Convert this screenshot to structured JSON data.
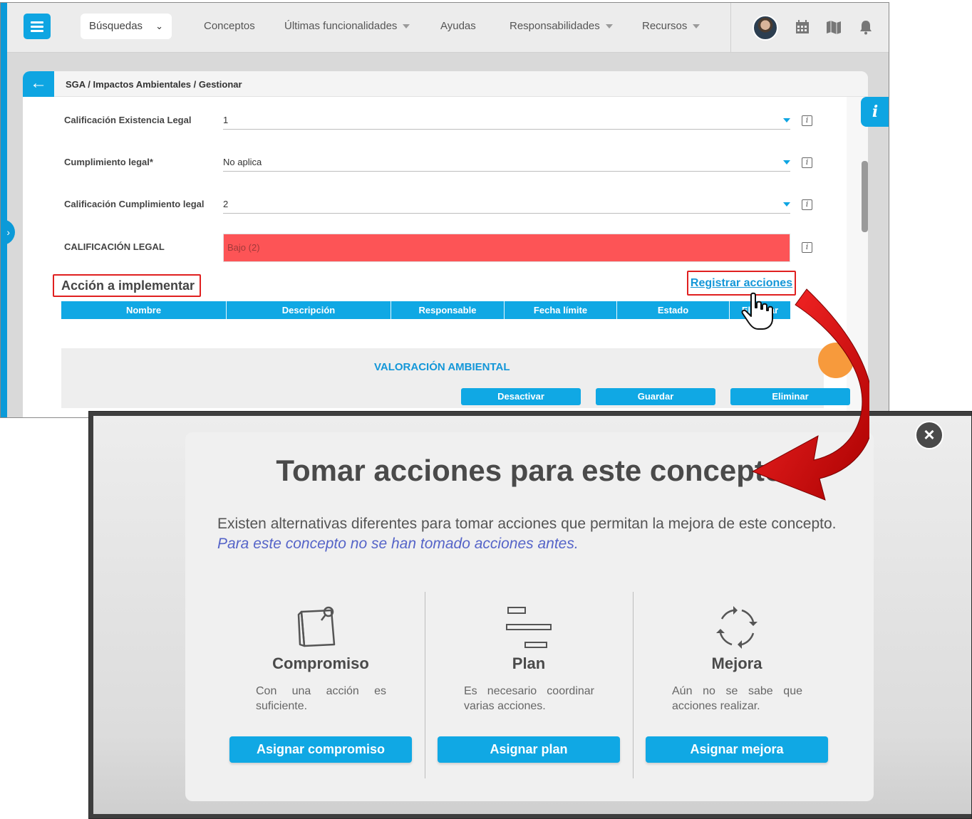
{
  "topbar": {
    "search_label": "Búsquedas",
    "nav": [
      {
        "label": "Conceptos",
        "dropdown": false
      },
      {
        "label": "Últimas funcionalidades",
        "dropdown": true
      },
      {
        "label": "Ayudas",
        "dropdown": false
      },
      {
        "label": "Responsabilidades",
        "dropdown": true
      },
      {
        "label": "Recursos",
        "dropdown": true
      }
    ],
    "icons": [
      "calendar-icon",
      "map-icon",
      "bell-icon"
    ]
  },
  "breadcrumb": "SGA / Impactos Ambientales / Gestionar",
  "form": {
    "fields": [
      {
        "label": "Calificación Existencia Legal",
        "value": "1"
      },
      {
        "label": "Cumplimiento legal*",
        "value": "No aplica"
      },
      {
        "label": "Calificación Cumplimiento legal",
        "value": "2"
      }
    ],
    "legal_label": "CALIFICACIÓN LEGAL",
    "legal_value": "Bajo (2)",
    "legal_color": "#fd5456"
  },
  "actions": {
    "section_title": "Acción a implementar",
    "register_link": "Registrar acciones",
    "table_headers": [
      "Nombre",
      "Descripción",
      "Responsable",
      "Fecha límite",
      "Estado",
      "Eliminar"
    ]
  },
  "valoracion": {
    "title": "VALORACIÓN AMBIENTAL",
    "buttons": [
      "Desactivar",
      "Guardar",
      "Eliminar"
    ]
  },
  "modal": {
    "title": "Tomar acciones para este concepto",
    "description": "Existen alternativas diferentes para tomar acciones que permitan la mejora de este concepto.",
    "note": "Para este concepto no se han tomado acciones antes.",
    "close_icon": "close-icon",
    "options": [
      {
        "title": "Compromiso",
        "description": "Con una acción es suficiente.",
        "button": "Asignar compromiso",
        "icon": "note-pin-icon"
      },
      {
        "title": "Plan",
        "description": "Es necesario coordinar varias acciones.",
        "button": "Asignar plan",
        "icon": "gantt-icon"
      },
      {
        "title": "Mejora",
        "description": "Aún no se sabe que acciones realizar.",
        "button": "Asignar mejora",
        "icon": "cycle-icon"
      }
    ]
  },
  "colors": {
    "accent": "#10a8e4",
    "highlight": "#e02020",
    "arrow": "#c40000"
  }
}
